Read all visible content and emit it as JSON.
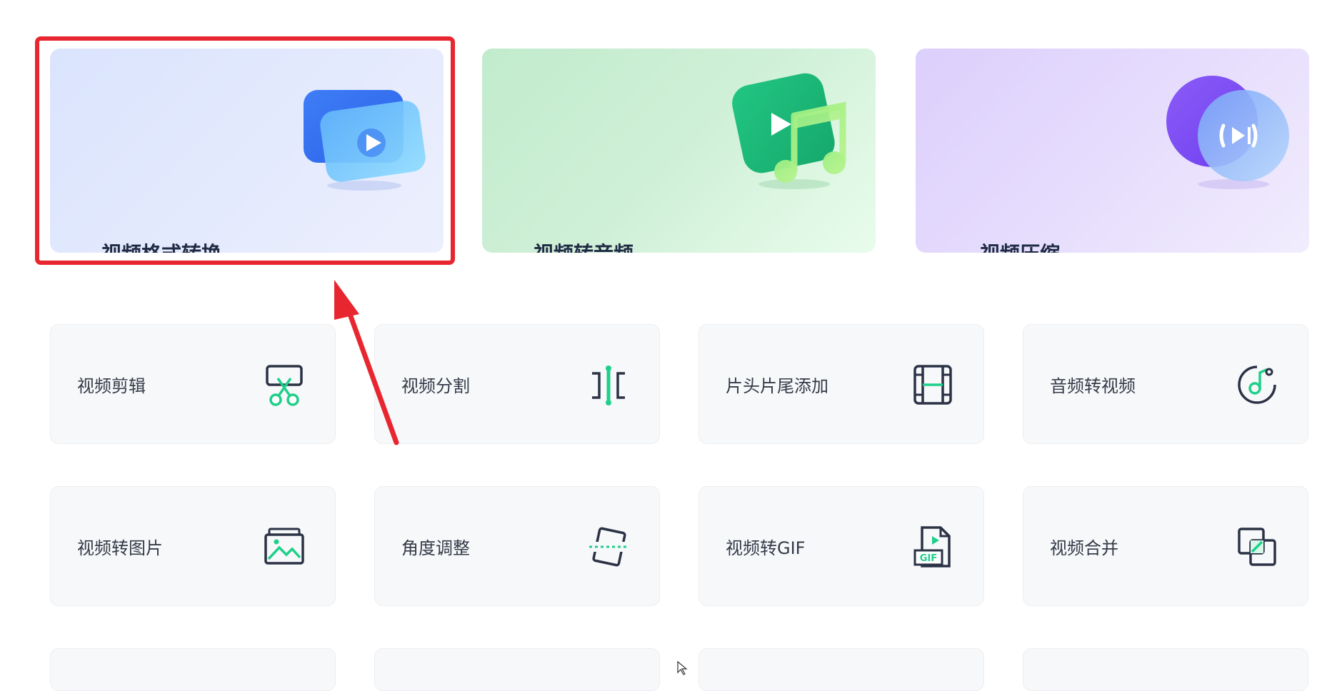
{
  "feature_cards": [
    {
      "label": "视频格式转换",
      "icon": "video-convert-icon",
      "highlighted": true
    },
    {
      "label": "视频转音频",
      "icon": "video-to-audio-icon",
      "highlighted": false
    },
    {
      "label": "视频压缩",
      "icon": "video-compress-icon",
      "highlighted": false
    }
  ],
  "tools": [
    {
      "label": "视频剪辑",
      "icon": "scissors-icon"
    },
    {
      "label": "视频分割",
      "icon": "split-icon"
    },
    {
      "label": "片头片尾添加",
      "icon": "film-strip-icon"
    },
    {
      "label": "音频转视频",
      "icon": "music-note-icon"
    },
    {
      "label": "视频转图片",
      "icon": "image-icon"
    },
    {
      "label": "角度调整",
      "icon": "rotate-icon"
    },
    {
      "label": "视频转GIF",
      "icon": "gif-file-icon"
    },
    {
      "label": "视频合并",
      "icon": "merge-icon"
    }
  ],
  "colors": {
    "accent": "#1fcf8a",
    "icon_dark": "#2b3245",
    "highlight": "#e8262f",
    "text": "#1f2a44"
  }
}
